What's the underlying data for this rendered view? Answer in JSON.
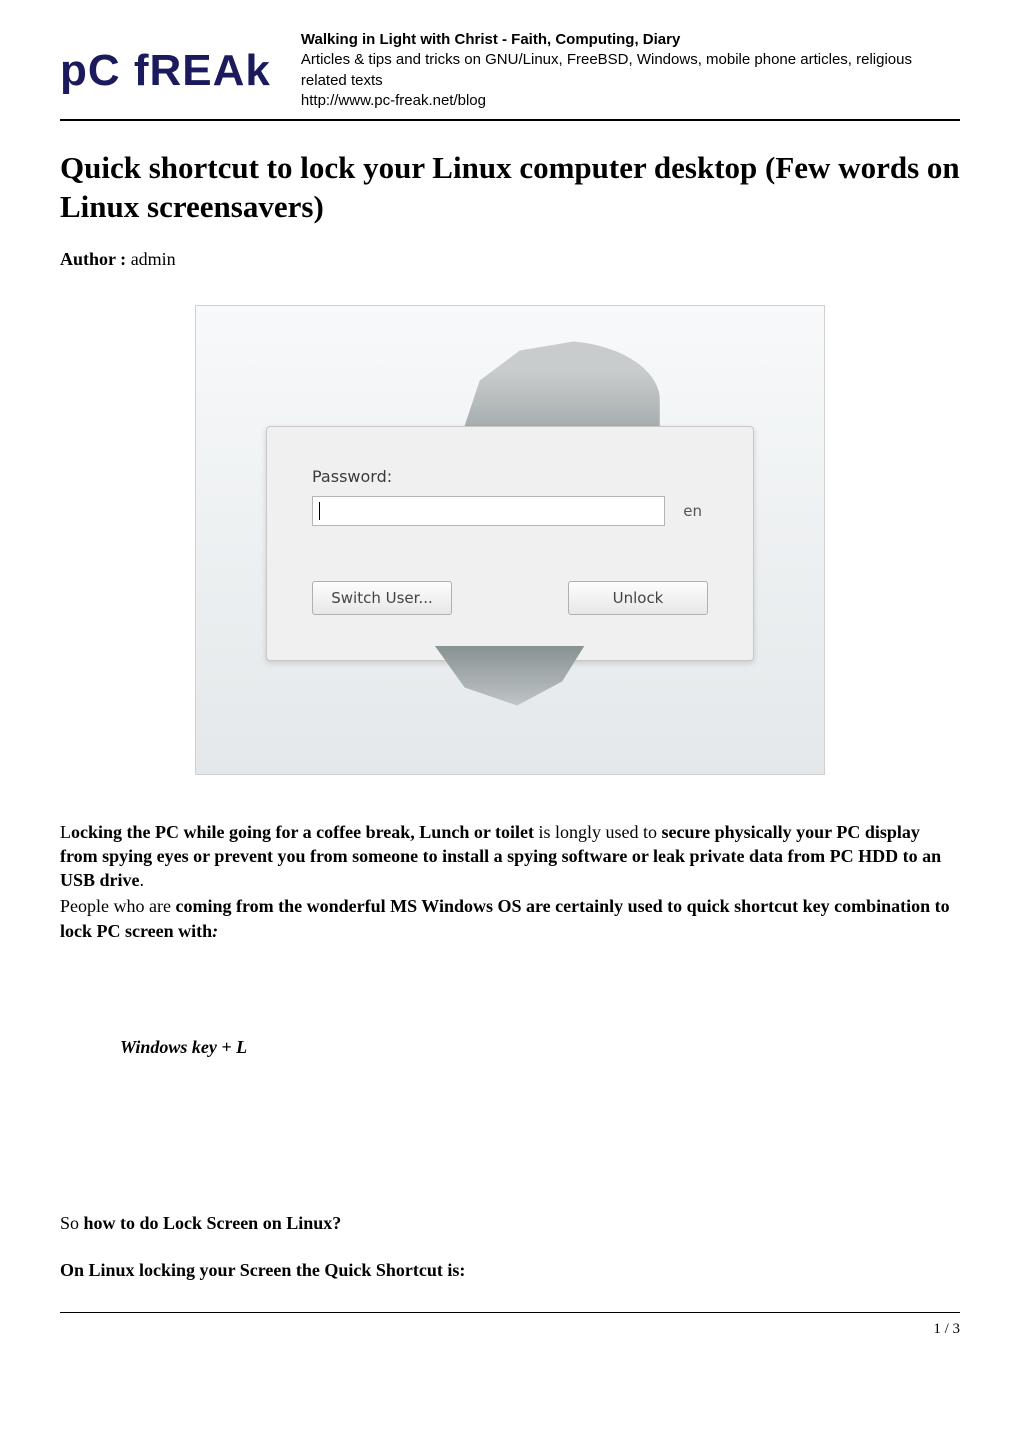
{
  "header": {
    "logo_text": "pC fREAk",
    "title": "Walking in Light with Christ - Faith, Computing, Diary",
    "subtitle": "Articles & tips and tricks on GNU/Linux, FreeBSD, Windows, mobile phone articles, religious related texts",
    "url": "http://www.pc-freak.net/blog"
  },
  "article": {
    "title": "Quick shortcut to lock your Linux computer desktop (Few words on Linux screensavers)",
    "author_label": "Author : ",
    "author_name": "admin"
  },
  "lockscreen": {
    "password_label": "Password:",
    "password_value": "",
    "lang_indicator": "en",
    "switch_user_label": "Switch User...",
    "unlock_label": "Unlock"
  },
  "body": {
    "p1_a": "L",
    "p1_b": "ocking the PC while going for a coffee break, Lunch or toilet",
    "p1_c": " is longly used to ",
    "p1_d": "secure physically your PC display from spying eyes or prevent you from  someone to install a spying software or leak private data from PC HDD to an USB drive",
    "p1_e": ".",
    "p2_a": "People who are ",
    "p2_b": "coming from the wonderful MS Windows OS   are certainly used to quick shortcut key combination to lock PC screen with",
    "p2_c": ":",
    "shortcut": "Windows key + L",
    "p3_a": " So ",
    "p3_b": "how to do Lock Screen on Linux?",
    "p4": " On Linux locking your Screen the Quick Shortcut is:"
  },
  "footer": {
    "page_indicator": "1 / 3"
  }
}
